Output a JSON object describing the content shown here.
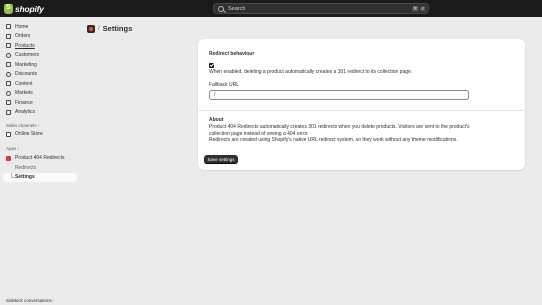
{
  "topbar": {
    "brand": "shopify",
    "search_placeholder": "Search",
    "shortcut_keys": [
      "⌘",
      "K"
    ]
  },
  "sidebar": {
    "items": [
      {
        "label": "Home",
        "icon": "home-icon"
      },
      {
        "label": "Orders",
        "icon": "orders-icon"
      },
      {
        "label": "Products",
        "icon": "products-icon"
      },
      {
        "label": "Customers",
        "icon": "customers-icon"
      },
      {
        "label": "Marketing",
        "icon": "marketing-icon"
      },
      {
        "label": "Discounts",
        "icon": "discounts-icon"
      },
      {
        "label": "Content",
        "icon": "content-icon"
      },
      {
        "label": "Markets",
        "icon": "markets-icon"
      },
      {
        "label": "Finance",
        "icon": "finance-icon"
      },
      {
        "label": "Analytics",
        "icon": "analytics-icon"
      }
    ],
    "sales_channels_label": "Sales channels",
    "online_store_label": "Online Store",
    "apps_label": "Apps",
    "app_name": "Product 404 Redirects",
    "app_subitems": [
      "Redirects",
      "Settings"
    ],
    "sidekick_label": "Sidekick conversations"
  },
  "page": {
    "separator": "/",
    "title": "Settings"
  },
  "settings": {
    "redirect_title": "Redirect behaviour",
    "checkbox_checked": true,
    "checkbox_description": "When enabled, deleting a product automatically creates a 301 redirect to its collection page.",
    "fallback_label": "Fallback URL",
    "fallback_value": "/",
    "about_title": "About",
    "about_line1": "Product 404 Redirects automatically creates 301 redirects when you delete products. Visitors are sent to the product's",
    "about_line2": "collection page instead of seeing a 404 error.",
    "about_line3": "Redirects are created using Shopify's native URL redirect system, so they work without any theme modifications.",
    "save_label": "Save settings"
  },
  "colors": {
    "topbar_bg": "#1a1a1a",
    "page_bg": "#ebebeb",
    "card_bg": "#ffffff",
    "primary_button": "#303030",
    "brand_green": "#95bf47"
  }
}
